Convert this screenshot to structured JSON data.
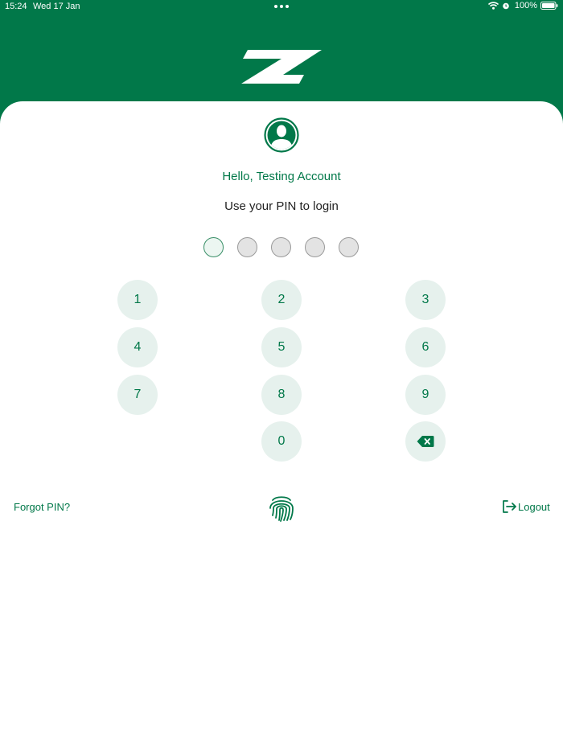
{
  "status_bar": {
    "time": "15:24",
    "date": "Wed 17 Jan",
    "battery": "100%",
    "icons": [
      "wifi-icon",
      "alarm-icon",
      "battery-icon"
    ]
  },
  "colors": {
    "brand_green": "#017849",
    "key_background": "#e6f1ed",
    "pin_empty": "#e3e3e3"
  },
  "login": {
    "greeting": "Hello, Testing Account",
    "instruction": "Use your PIN to login",
    "pin_length": 5,
    "pin_entered": 0
  },
  "keypad": {
    "keys": [
      "1",
      "2",
      "3",
      "4",
      "5",
      "6",
      "7",
      "8",
      "9",
      "0"
    ],
    "delete_icon": "backspace-icon"
  },
  "footer": {
    "forgot_label": "Forgot PIN?",
    "biometric_icon": "fingerprint-icon",
    "logout_label": "Logout",
    "logout_icon": "logout-icon"
  }
}
